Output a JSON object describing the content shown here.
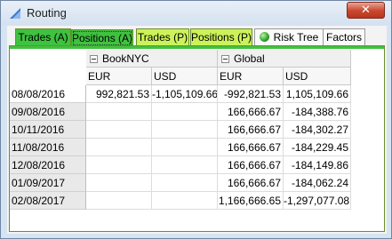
{
  "window": {
    "title": "Routing",
    "close_glyph": "✕"
  },
  "tabs": [
    {
      "label": "Trades (A)",
      "color": "#3fc23f"
    },
    {
      "label": "Positions (A)",
      "color": "#3fc23f",
      "active": true
    },
    {
      "label": "Trades (P)",
      "color": "#ccf25a"
    },
    {
      "label": "Positions (P)",
      "color": "#ccf25a"
    },
    {
      "label": "Risk Tree",
      "icon": "green-ball-icon",
      "color": "#fafafa"
    },
    {
      "label": "Factors",
      "color": "#fafafa"
    }
  ],
  "grid": {
    "groups": [
      {
        "label": "BookNYC",
        "icon": "collapse-minus-icon"
      },
      {
        "label": "Global",
        "icon": "collapse-minus-icon"
      }
    ],
    "columns": [
      "EUR",
      "USD",
      "EUR",
      "USD"
    ],
    "rows": [
      {
        "date": "08/08/2016",
        "values": [
          "992,821.53",
          "-1,105,109.66",
          "-992,821.53",
          "1,105,109.66"
        ]
      },
      {
        "date": "09/08/2016",
        "values": [
          "",
          "",
          "166,666.67",
          "-184,388.76"
        ]
      },
      {
        "date": "10/11/2016",
        "values": [
          "",
          "",
          "166,666.67",
          "-184,302.27"
        ]
      },
      {
        "date": "11/08/2016",
        "values": [
          "",
          "",
          "166,666.67",
          "-184,229.45"
        ]
      },
      {
        "date": "12/08/2016",
        "values": [
          "",
          "",
          "166,666.67",
          "-184,149.86"
        ]
      },
      {
        "date": "01/09/2017",
        "values": [
          "",
          "",
          "166,666.67",
          "-184,062.24"
        ]
      },
      {
        "date": "02/08/2017",
        "values": [
          "",
          "",
          "1,166,666.65",
          "-1,297,077.08"
        ]
      }
    ]
  }
}
